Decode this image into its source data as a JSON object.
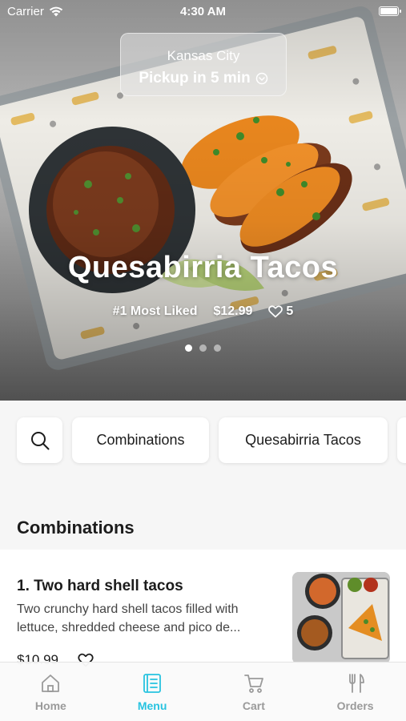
{
  "status_bar": {
    "carrier": "Carrier",
    "time": "4:30 AM"
  },
  "location": {
    "city": "Kansas City",
    "pickup": "Pickup in 5 min"
  },
  "hero": {
    "title": "Quesabirria Tacos",
    "badge": "#1 Most Liked",
    "price": "$12.99",
    "likes": "5",
    "carousel": {
      "total": 3,
      "active": 1
    }
  },
  "categories": [
    "Combinations",
    "Quesabirria Tacos"
  ],
  "section": {
    "title": "Combinations"
  },
  "item": {
    "name": "1. Two hard shell tacos",
    "description": "Two crunchy hard shell tacos filled with lettuce, shredded cheese and pico de...",
    "price": "$10.99"
  },
  "tabs": [
    {
      "label": "Home",
      "icon": "home-icon",
      "active": false
    },
    {
      "label": "Menu",
      "icon": "menu-book-icon",
      "active": true
    },
    {
      "label": "Cart",
      "icon": "cart-icon",
      "active": false
    },
    {
      "label": "Orders",
      "icon": "fork-knife-icon",
      "active": false
    }
  ],
  "colors": {
    "accent": "#27c3e0",
    "inactive": "#9a9a9a"
  }
}
